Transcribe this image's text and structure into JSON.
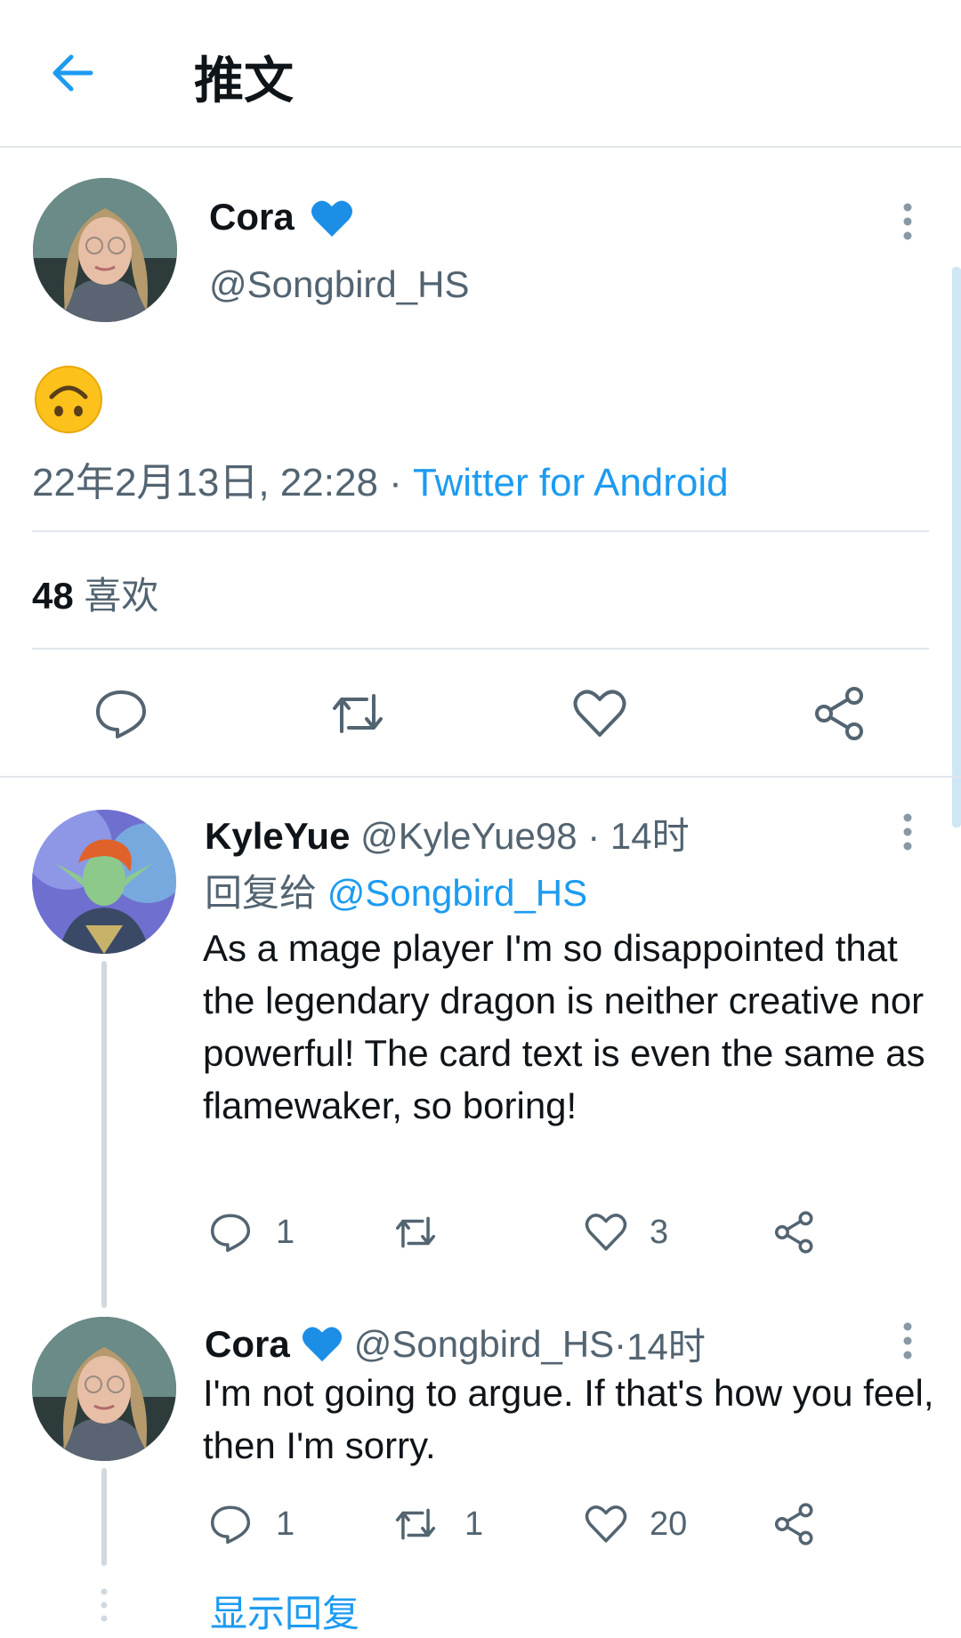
{
  "header": {
    "title": "推文"
  },
  "main_tweet": {
    "author_name": "Cora",
    "author_handle": "@Songbird_HS",
    "content_emoji": "upside-down-face",
    "timestamp": "22年2月13日, 22:28",
    "separator": " · ",
    "source": "Twitter for Android",
    "likes_count": "48",
    "likes_label": "喜欢"
  },
  "replies": [
    {
      "author_name": "KyleYue",
      "author_handle": "@KyleYue98",
      "time": "14时",
      "separator": " · ",
      "reply_to_label": "回复给",
      "reply_to_handle": "@Songbird_HS",
      "text": "As a mage player I'm so disappointed that the legendary dragon is neither creative nor powerful! The card text is even the same as flamewaker, so boring!",
      "reply_count": "1",
      "retweet_count": "",
      "like_count": "3"
    },
    {
      "author_name": "Cora",
      "author_handle": "@Songbird_HS",
      "time": "14时",
      "separator": " · ",
      "text": "I'm not going to argue. If that's how you feel, then I'm sorry.",
      "reply_count": "1",
      "retweet_count": "1",
      "like_count": "20"
    }
  ],
  "show_replies_label": "显示回复",
  "colors": {
    "accent": "#1d9bf0",
    "verified_heart": "#1d8ee6",
    "text": "#0f1419",
    "muted": "#536471",
    "divider": "#e1e6ea"
  },
  "icons": [
    "back-arrow-icon",
    "blue-heart-icon",
    "more-vertical-icon",
    "reply-icon",
    "retweet-icon",
    "like-icon",
    "share-icon"
  ]
}
